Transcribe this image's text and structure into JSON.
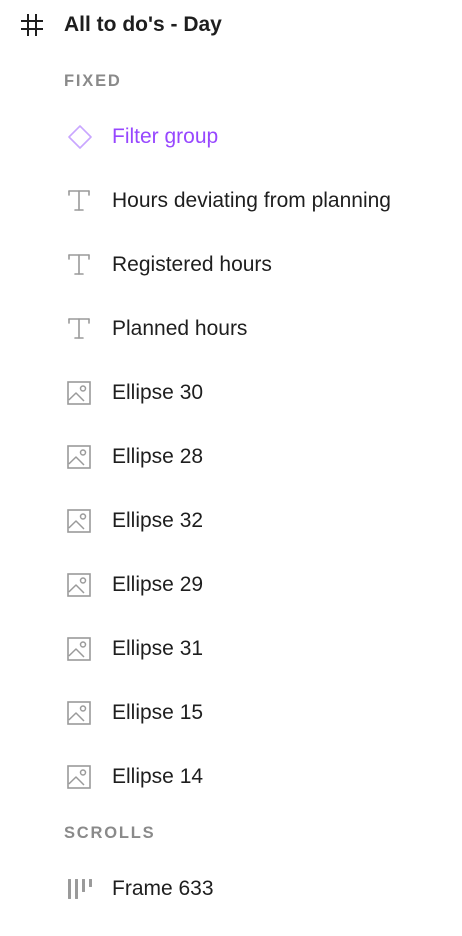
{
  "frame": {
    "title": "All to do's - Day",
    "icon": "frame-hash-icon"
  },
  "sections": {
    "fixed_label": "FIXED",
    "scrolls_label": "SCROLLS"
  },
  "fixed_layers": [
    {
      "label": "Filter group",
      "icon": "component-instance-icon",
      "color": "#9747ff"
    },
    {
      "label": "Hours deviating from planning",
      "icon": "text-layer-icon"
    },
    {
      "label": "Registered hours",
      "icon": "text-layer-icon"
    },
    {
      "label": "Planned hours",
      "icon": "text-layer-icon"
    },
    {
      "label": "Ellipse 30",
      "icon": "image-layer-icon"
    },
    {
      "label": "Ellipse 28",
      "icon": "image-layer-icon"
    },
    {
      "label": "Ellipse 32",
      "icon": "image-layer-icon"
    },
    {
      "label": "Ellipse 29",
      "icon": "image-layer-icon"
    },
    {
      "label": "Ellipse 31",
      "icon": "image-layer-icon"
    },
    {
      "label": "Ellipse 15",
      "icon": "image-layer-icon"
    },
    {
      "label": "Ellipse 14",
      "icon": "image-layer-icon"
    }
  ],
  "scroll_layers": [
    {
      "label": "Frame 633",
      "icon": "horizontal-auto-layout-icon"
    }
  ],
  "colors": {
    "text": "#1e1e1e",
    "section": "#8a8a8a",
    "icon": "#9a9a9a",
    "component": "#9747ff"
  }
}
